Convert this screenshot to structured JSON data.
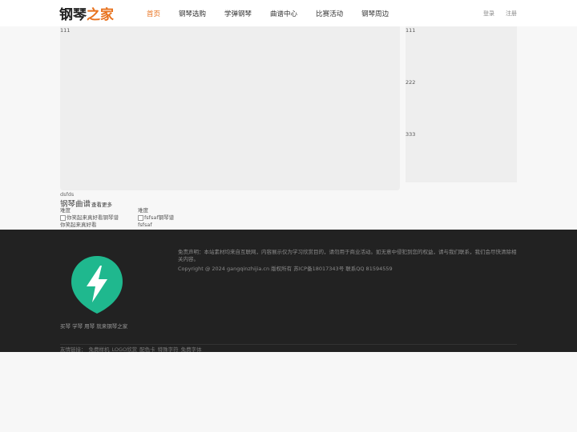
{
  "header": {
    "logo_part1": "钢琴",
    "logo_part2": "之家",
    "nav": [
      {
        "label": "首页",
        "active": true
      },
      {
        "label": "钢琴选购",
        "active": false
      },
      {
        "label": "学弹钢琴",
        "active": false
      },
      {
        "label": "曲谱中心",
        "active": false
      },
      {
        "label": "比赛活动",
        "active": false
      },
      {
        "label": "钢琴周边",
        "active": false
      }
    ],
    "login": "登录",
    "register": "注册"
  },
  "banner": {
    "main_label": "111",
    "side_items": [
      "111",
      "222",
      "333"
    ]
  },
  "caption": "dsfds",
  "section": {
    "title": "钢琴曲谱",
    "more": "查看更多"
  },
  "cards": [
    {
      "difficulty": "难度",
      "img_alt": "你笑起来真好看钢琴谱",
      "title": "你笑起来真好看"
    },
    {
      "difficulty": "难度",
      "img_alt": "fsfsaf钢琴谱",
      "title": "fsfsaf"
    }
  ],
  "footer": {
    "links_text": "买琴 学琴 用琴 就来钢琴之家",
    "disclaimer": "免责声明：本站素材均来自互联网，内容展示仅为学习欣赏目的，请勿用于商业活动。如无意中侵犯到您的权益，请与我们联系，我们会尽快清除相关内容。",
    "copyright": "Copyright @ 2024 gangqinzhijia.cn 版权所有 苏ICP备18017343号 联系QQ 81594559",
    "friends_label": "友情链接：",
    "friends": [
      "免费样机",
      "LOGO欣赏",
      "配色卡",
      "特殊字符",
      "免费字体"
    ]
  },
  "colors": {
    "accent": "#e8721e",
    "footer_bg": "#222222",
    "logo_green": "#1fb88e"
  }
}
